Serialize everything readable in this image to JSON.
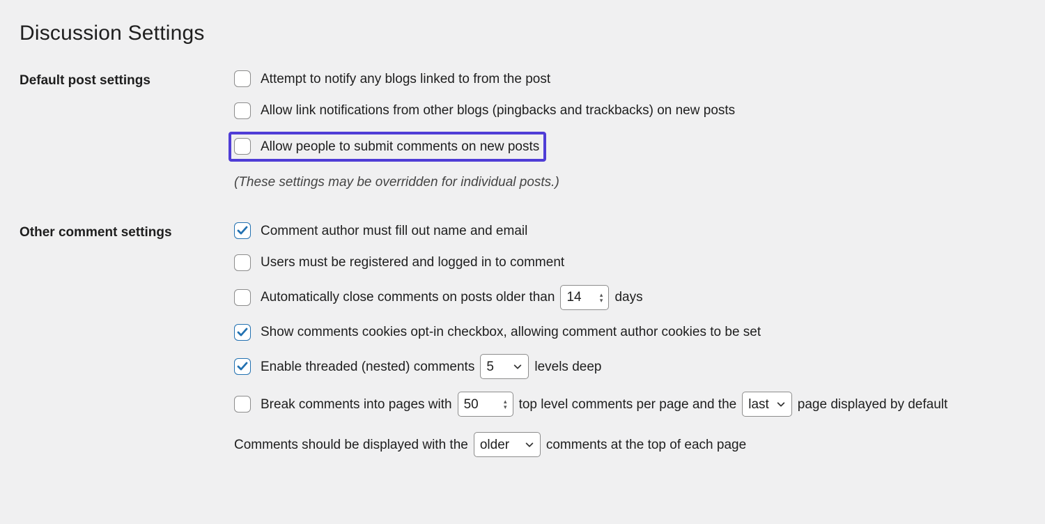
{
  "page_title": "Discussion Settings",
  "sections": {
    "default_post": {
      "label": "Default post settings",
      "opt_notify": "Attempt to notify any blogs linked to from the post",
      "opt_pingback": "Allow link notifications from other blogs (pingbacks and trackbacks) on new posts",
      "opt_allow_comments": "Allow people to submit comments on new posts",
      "note": "(These settings may be overridden for individual posts.)",
      "checked": {
        "notify": false,
        "pingback": false,
        "allow_comments": false
      }
    },
    "other_comment": {
      "label": "Other comment settings",
      "opt_author_fill": "Comment author must fill out name and email",
      "opt_registered": "Users must be registered and logged in to comment",
      "opt_auto_close_pre": "Automatically close comments on posts older than",
      "opt_auto_close_post": "days",
      "auto_close_days": "14",
      "opt_cookies": "Show comments cookies opt-in checkbox, allowing comment author cookies to be set",
      "opt_threaded_pre": "Enable threaded (nested) comments",
      "opt_threaded_post": "levels deep",
      "threaded_levels": "5",
      "opt_paginate_pre": "Break comments into pages with",
      "opt_paginate_mid": "top level comments per page and the",
      "opt_paginate_post": "page displayed by default",
      "paginate_count": "50",
      "paginate_which": "last",
      "opt_order_pre": "Comments should be displayed with the",
      "opt_order_post": "comments at the top of each page",
      "order_which": "older",
      "checked": {
        "author_fill": true,
        "registered": false,
        "auto_close": false,
        "cookies": true,
        "threaded": true,
        "paginate": false
      }
    }
  }
}
